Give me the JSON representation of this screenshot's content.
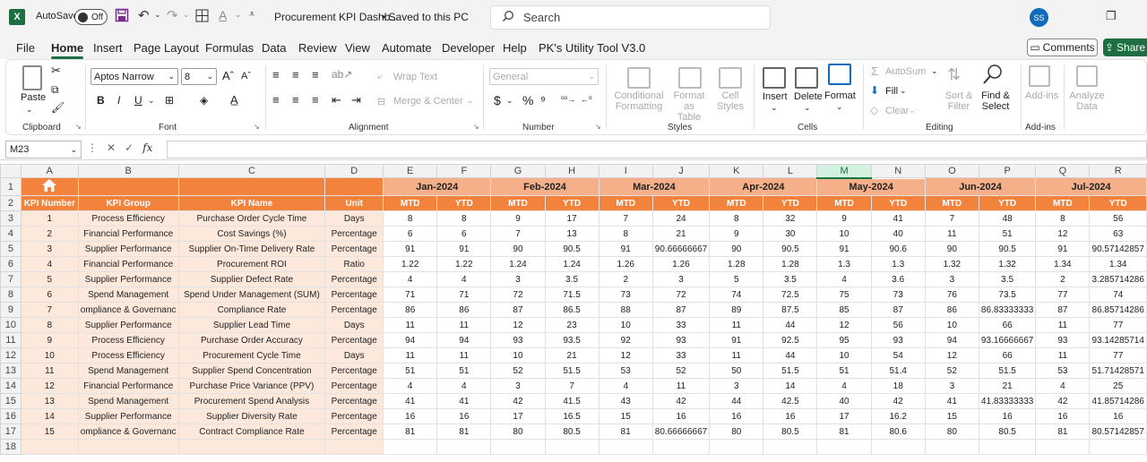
{
  "titlebar": {
    "app_icon": "X",
    "autosave_label": "AutoSave",
    "autosave_state": "Off",
    "doc_title": "Procurement KPI Dashb...",
    "saved_status": "• Saved to this PC",
    "search_placeholder": "Search",
    "user_initials": "SS"
  },
  "menu": {
    "items": [
      "File",
      "Home",
      "Insert",
      "Page Layout",
      "Formulas",
      "Data",
      "Review",
      "View",
      "Automate",
      "Developer",
      "Help",
      "PK's Utility Tool V3.0"
    ],
    "active": "Home",
    "comments_label": "Comments",
    "share_label": "Share"
  },
  "ribbon": {
    "clipboard": {
      "label": "Clipboard",
      "paste": "Paste"
    },
    "font": {
      "label": "Font",
      "name": "Aptos Narrow",
      "size": "8"
    },
    "alignment": {
      "label": "Alignment",
      "wrap": "Wrap Text",
      "merge": "Merge & Center"
    },
    "number": {
      "label": "Number",
      "format": "General"
    },
    "styles": {
      "label": "Styles",
      "cond1": "Conditional",
      "cond2": "Formatting",
      "fmt1": "Format as",
      "fmt2": "Table",
      "cell1": "Cell",
      "cell2": "Styles"
    },
    "cells": {
      "label": "Cells",
      "insert": "Insert",
      "delete": "Delete",
      "format": "Format"
    },
    "editing": {
      "label": "Editing",
      "autosum": "AutoSum",
      "fill": "Fill",
      "clear": "Clear",
      "sort1": "Sort &",
      "sort2": "Filter",
      "find1": "Find &",
      "find2": "Select"
    },
    "addins": {
      "label": "Add-ins",
      "addins": "Add-ins",
      "analyze1": "Analyze",
      "analyze2": "Data"
    }
  },
  "formula_bar": {
    "name_box": "M23",
    "fx": "fx",
    "content": ""
  },
  "sheet": {
    "columns": [
      "A",
      "B",
      "C",
      "D",
      "E",
      "F",
      "G",
      "H",
      "I",
      "J",
      "K",
      "L",
      "M",
      "N",
      "O",
      "P",
      "Q",
      "R"
    ],
    "selected_column": "M",
    "row_numbers": [
      "1",
      "2",
      "3",
      "4",
      "5",
      "6",
      "7",
      "8",
      "9",
      "10",
      "11",
      "12",
      "13",
      "14",
      "15",
      "16",
      "17",
      "18"
    ],
    "months": [
      "Jan-2024",
      "Feb-2024",
      "Mar-2024",
      "Apr-2024",
      "May-2024",
      "Jun-2024",
      "Jul-2024"
    ],
    "headers": [
      "KPI Number",
      "KPI Group",
      "KPI Name",
      "Unit",
      "MTD",
      "YTD",
      "MTD",
      "YTD",
      "MTD",
      "YTD",
      "MTD",
      "YTD",
      "MTD",
      "YTD",
      "MTD",
      "YTD",
      "MTD",
      "YTD"
    ],
    "rows": [
      [
        "1",
        "Process Efficiency",
        "Purchase Order Cycle Time",
        "Days",
        "8",
        "8",
        "9",
        "17",
        "7",
        "24",
        "8",
        "32",
        "9",
        "41",
        "7",
        "48",
        "8",
        "56"
      ],
      [
        "2",
        "Financial Performance",
        "Cost Savings (%)",
        "Percentage",
        "6",
        "6",
        "7",
        "13",
        "8",
        "21",
        "9",
        "30",
        "10",
        "40",
        "11",
        "51",
        "12",
        "63"
      ],
      [
        "3",
        "Supplier Performance",
        "Supplier On-Time Delivery Rate",
        "Percentage",
        "91",
        "91",
        "90",
        "90.5",
        "91",
        "90.66666667",
        "90",
        "90.5",
        "91",
        "90.6",
        "90",
        "90.5",
        "91",
        "90.57142857"
      ],
      [
        "4",
        "Financial Performance",
        "Procurement ROI",
        "Ratio",
        "1.22",
        "1.22",
        "1.24",
        "1.24",
        "1.26",
        "1.26",
        "1.28",
        "1.28",
        "1.3",
        "1.3",
        "1.32",
        "1.32",
        "1.34",
        "1.34"
      ],
      [
        "5",
        "Supplier Performance",
        "Supplier Defect Rate",
        "Percentage",
        "4",
        "4",
        "3",
        "3.5",
        "2",
        "3",
        "5",
        "3.5",
        "4",
        "3.6",
        "3",
        "3.5",
        "2",
        "3.285714286"
      ],
      [
        "6",
        "Spend Management",
        "Spend Under Management (SUM)",
        "Percentage",
        "71",
        "71",
        "72",
        "71.5",
        "73",
        "72",
        "74",
        "72.5",
        "75",
        "73",
        "76",
        "73.5",
        "77",
        "74"
      ],
      [
        "7",
        "ompliance & Governanc",
        "Compliance Rate",
        "Percentage",
        "86",
        "86",
        "87",
        "86.5",
        "88",
        "87",
        "89",
        "87.5",
        "85",
        "87",
        "86",
        "86.83333333",
        "87",
        "86.85714286"
      ],
      [
        "8",
        "Supplier Performance",
        "Supplier Lead Time",
        "Days",
        "11",
        "11",
        "12",
        "23",
        "10",
        "33",
        "11",
        "44",
        "12",
        "56",
        "10",
        "66",
        "11",
        "77"
      ],
      [
        "9",
        "Process Efficiency",
        "Purchase Order Accuracy",
        "Percentage",
        "94",
        "94",
        "93",
        "93.5",
        "92",
        "93",
        "91",
        "92.5",
        "95",
        "93",
        "94",
        "93.16666667",
        "93",
        "93.14285714"
      ],
      [
        "10",
        "Process Efficiency",
        "Procurement Cycle Time",
        "Days",
        "11",
        "11",
        "10",
        "21",
        "12",
        "33",
        "11",
        "44",
        "10",
        "54",
        "12",
        "66",
        "11",
        "77"
      ],
      [
        "11",
        "Spend Management",
        "Supplier Spend Concentration",
        "Percentage",
        "51",
        "51",
        "52",
        "51.5",
        "53",
        "52",
        "50",
        "51.5",
        "51",
        "51.4",
        "52",
        "51.5",
        "53",
        "51.71428571"
      ],
      [
        "12",
        "Financial Performance",
        "Purchase Price Variance (PPV)",
        "Percentage",
        "4",
        "4",
        "3",
        "7",
        "4",
        "11",
        "3",
        "14",
        "4",
        "18",
        "3",
        "21",
        "4",
        "25"
      ],
      [
        "13",
        "Spend Management",
        "Procurement Spend Analysis",
        "Percentage",
        "41",
        "41",
        "42",
        "41.5",
        "43",
        "42",
        "44",
        "42.5",
        "40",
        "42",
        "41",
        "41.83333333",
        "42",
        "41.85714286"
      ],
      [
        "14",
        "Supplier Performance",
        "Supplier Diversity Rate",
        "Percentage",
        "16",
        "16",
        "17",
        "16.5",
        "15",
        "16",
        "16",
        "16",
        "17",
        "16.2",
        "15",
        "16",
        "16",
        "16"
      ],
      [
        "15",
        "ompliance & Governanc",
        "Contract Compliance Rate",
        "Percentage",
        "81",
        "81",
        "80",
        "80.5",
        "81",
        "80.66666667",
        "80",
        "80.5",
        "81",
        "80.6",
        "80",
        "80.5",
        "81",
        "80.57142857"
      ]
    ]
  },
  "colors": {
    "accent_green": "#1d6f42",
    "header_orange": "#f3823d",
    "month_orange": "#f5b089",
    "peach": "#fde9dc"
  }
}
